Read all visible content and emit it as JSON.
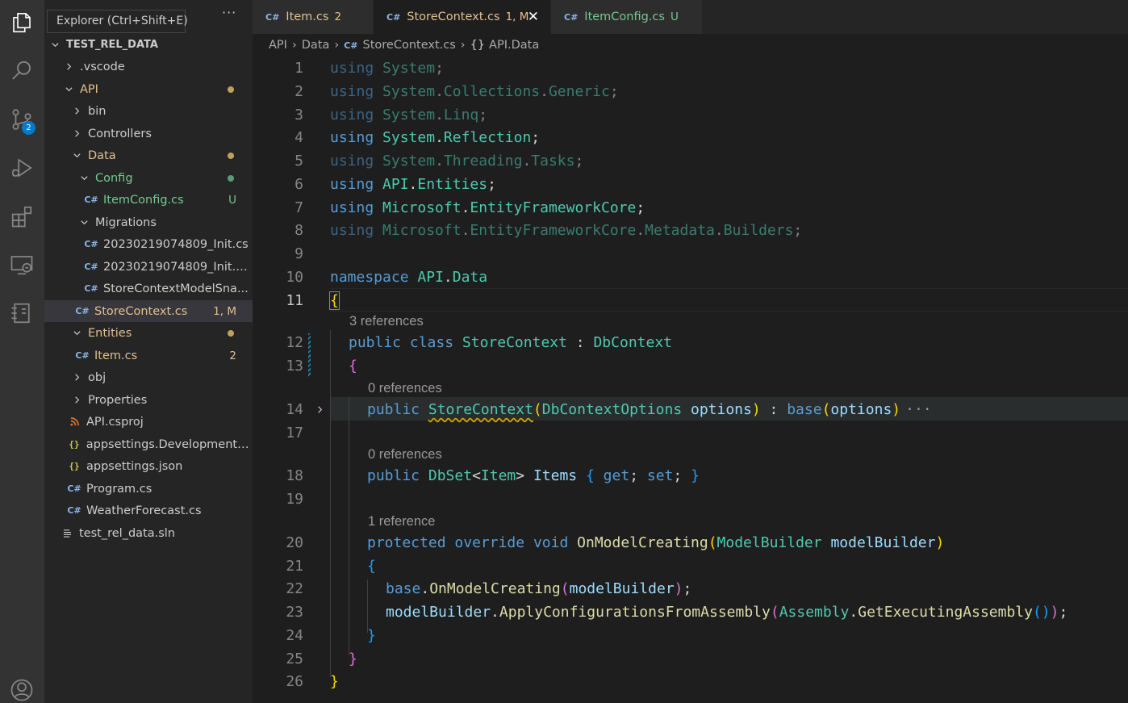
{
  "tooltip": "Explorer (Ctrl+Shift+E)",
  "activity": {
    "items": [
      {
        "name": "files-icon",
        "label": "Explorer"
      },
      {
        "name": "search-icon",
        "label": "Search"
      },
      {
        "name": "source-control-icon",
        "label": "Source Control"
      },
      {
        "name": "run-debug-icon",
        "label": "Run and Debug"
      },
      {
        "name": "extensions-icon",
        "label": "Extensions"
      },
      {
        "name": "remote-explorer-icon",
        "label": "Remote Explorer"
      },
      {
        "name": "notebook-icon",
        "label": "Notebook"
      },
      {
        "name": "accounts-icon",
        "label": "Accounts"
      }
    ],
    "source_control_badge": "2"
  },
  "explorer": {
    "more": "···",
    "root": "TEST_REL_DATA",
    "rows": [
      {
        "label": ".vscode",
        "stat": "",
        "dot": ""
      },
      {
        "label": "API",
        "stat": "",
        "dot": "#e2c08d"
      },
      {
        "label": "bin",
        "stat": "",
        "dot": ""
      },
      {
        "label": "Controllers",
        "stat": "",
        "dot": ""
      },
      {
        "label": "Data",
        "stat": "",
        "dot": "#e2c08d"
      },
      {
        "label": "Config",
        "stat": "",
        "dot": "#73c991"
      },
      {
        "label": "ItemConfig.cs",
        "stat": "U",
        "dot": ""
      },
      {
        "label": "Migrations",
        "stat": "",
        "dot": ""
      },
      {
        "label": "20230219074809_Init.cs",
        "stat": "",
        "dot": ""
      },
      {
        "label": "20230219074809_Init.D...",
        "stat": "",
        "dot": ""
      },
      {
        "label": "StoreContextModelSna...",
        "stat": "",
        "dot": ""
      },
      {
        "label": "StoreContext.cs",
        "stat": "1, M",
        "dot": ""
      },
      {
        "label": "Entities",
        "stat": "",
        "dot": "#e2c08d"
      },
      {
        "label": "Item.cs",
        "stat": "2",
        "dot": ""
      },
      {
        "label": "obj",
        "stat": "",
        "dot": ""
      },
      {
        "label": "Properties",
        "stat": "",
        "dot": ""
      },
      {
        "label": "API.csproj",
        "stat": "",
        "dot": ""
      },
      {
        "label": "appsettings.Development.j...",
        "stat": "",
        "dot": ""
      },
      {
        "label": "appsettings.json",
        "stat": "",
        "dot": ""
      },
      {
        "label": "Program.cs",
        "stat": "",
        "dot": ""
      },
      {
        "label": "WeatherForecast.cs",
        "stat": "",
        "dot": ""
      },
      {
        "label": "test_rel_data.sln",
        "stat": "",
        "dot": ""
      }
    ]
  },
  "tabs": [
    {
      "label": "Item.cs",
      "stat": "2",
      "icon": "C#"
    },
    {
      "label": "StoreContext.cs",
      "stat": "1, M",
      "icon": "C#",
      "close": "✕"
    },
    {
      "label": "ItemConfig.cs",
      "stat": "U",
      "icon": "C#"
    }
  ],
  "breadcrumb": {
    "items": [
      "API",
      "Data",
      "StoreContext.cs",
      "API.Data"
    ],
    "sep": "›",
    "ns_icon": "{}"
  },
  "editor": {
    "line_numbers": [
      "1",
      "2",
      "3",
      "4",
      "5",
      "6",
      "7",
      "8",
      "9",
      "10",
      "11",
      "12",
      "13",
      "14",
      "17",
      "18",
      "19",
      "20",
      "21",
      "22",
      "23",
      "24",
      "25",
      "26"
    ],
    "current_line": "11",
    "codelens": [
      "3 references",
      "0 references",
      "0 references",
      "1 reference"
    ],
    "fold_ellipsis": "···",
    "colors": {
      "keyword": "#569cd6",
      "control": "#c586c0",
      "type": "#4ec9b0",
      "function": "#dcdcaa",
      "variable": "#9cdcfe"
    },
    "lines": [
      {
        "ln": "1",
        "text": "using System;"
      },
      {
        "ln": "2",
        "text": "using System.Collections.Generic;"
      },
      {
        "ln": "3",
        "text": "using System.Linq;"
      },
      {
        "ln": "4",
        "text": "using System.Reflection;"
      },
      {
        "ln": "5",
        "text": "using System.Threading.Tasks;"
      },
      {
        "ln": "6",
        "text": "using API.Entities;"
      },
      {
        "ln": "7",
        "text": "using Microsoft.EntityFrameworkCore;"
      },
      {
        "ln": "8",
        "text": "using Microsoft.EntityFrameworkCore.Metadata.Builders;"
      },
      {
        "ln": "9",
        "text": ""
      },
      {
        "ln": "10",
        "text": "namespace API.Data"
      },
      {
        "ln": "11",
        "text": "{"
      },
      {
        "ln": "12",
        "text": "public class StoreContext : DbContext"
      },
      {
        "ln": "13",
        "text": "{"
      },
      {
        "ln": "14",
        "text": "public StoreContext(DbContextOptions options) : base(options)"
      },
      {
        "ln": "17",
        "text": ""
      },
      {
        "ln": "18",
        "text": "public DbSet<Item> Items { get; set; }"
      },
      {
        "ln": "19",
        "text": ""
      },
      {
        "ln": "20",
        "text": "protected override void OnModelCreating(ModelBuilder modelBuilder)"
      },
      {
        "ln": "21",
        "text": "{"
      },
      {
        "ln": "22",
        "text": "base.OnModelCreating(modelBuilder);"
      },
      {
        "ln": "23",
        "text": "modelBuilder.ApplyConfigurationsFromAssembly(Assembly.GetExecutingAssembly());"
      },
      {
        "ln": "24",
        "text": "}"
      },
      {
        "ln": "25",
        "text": "}"
      },
      {
        "ln": "26",
        "text": "}"
      }
    ]
  }
}
